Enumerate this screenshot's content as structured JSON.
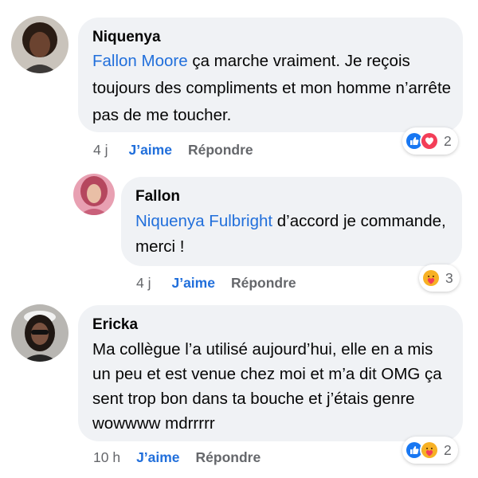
{
  "comments": [
    {
      "author": "Niquenya",
      "mention": "Fallon Moore",
      "text": " ça marche vraiment. Je reçois toujours des compliments et mon homme n’arrête pas de me toucher.",
      "time": "4 j",
      "like_label": "J’aime",
      "reply_label": "Répondre",
      "reaction_icons": [
        "like-icon",
        "love-icon"
      ],
      "reaction_count": "2"
    },
    {
      "author": "Fallon",
      "mention": "Niquenya Fulbright",
      "text": " d’accord je commande, merci !",
      "time": "4 j",
      "like_label": "J’aime",
      "reply_label": "Répondre",
      "reaction_icons": [
        "care-icon"
      ],
      "reaction_count": "3"
    },
    {
      "author": "Ericka",
      "mention": "",
      "text": "Ma collègue l’a utilisé aujourd’hui, elle en a mis un peu et est venue chez moi et m’a dit OMG ça sent trop bon dans ta bouche et j’étais genre wowwww mdrrrrr",
      "time": "10 h",
      "like_label": "J’aime",
      "reply_label": "Répondre",
      "reaction_icons": [
        "like-icon",
        "care-icon"
      ],
      "reaction_count": "2"
    }
  ],
  "colors": {
    "link_blue": "#216fdb",
    "bubble_bg": "#f0f2f5",
    "meta_gray": "#65676b",
    "like_blue": "#1877f2",
    "love_red": "#f33e58",
    "care_yellow": "#f7b125"
  }
}
